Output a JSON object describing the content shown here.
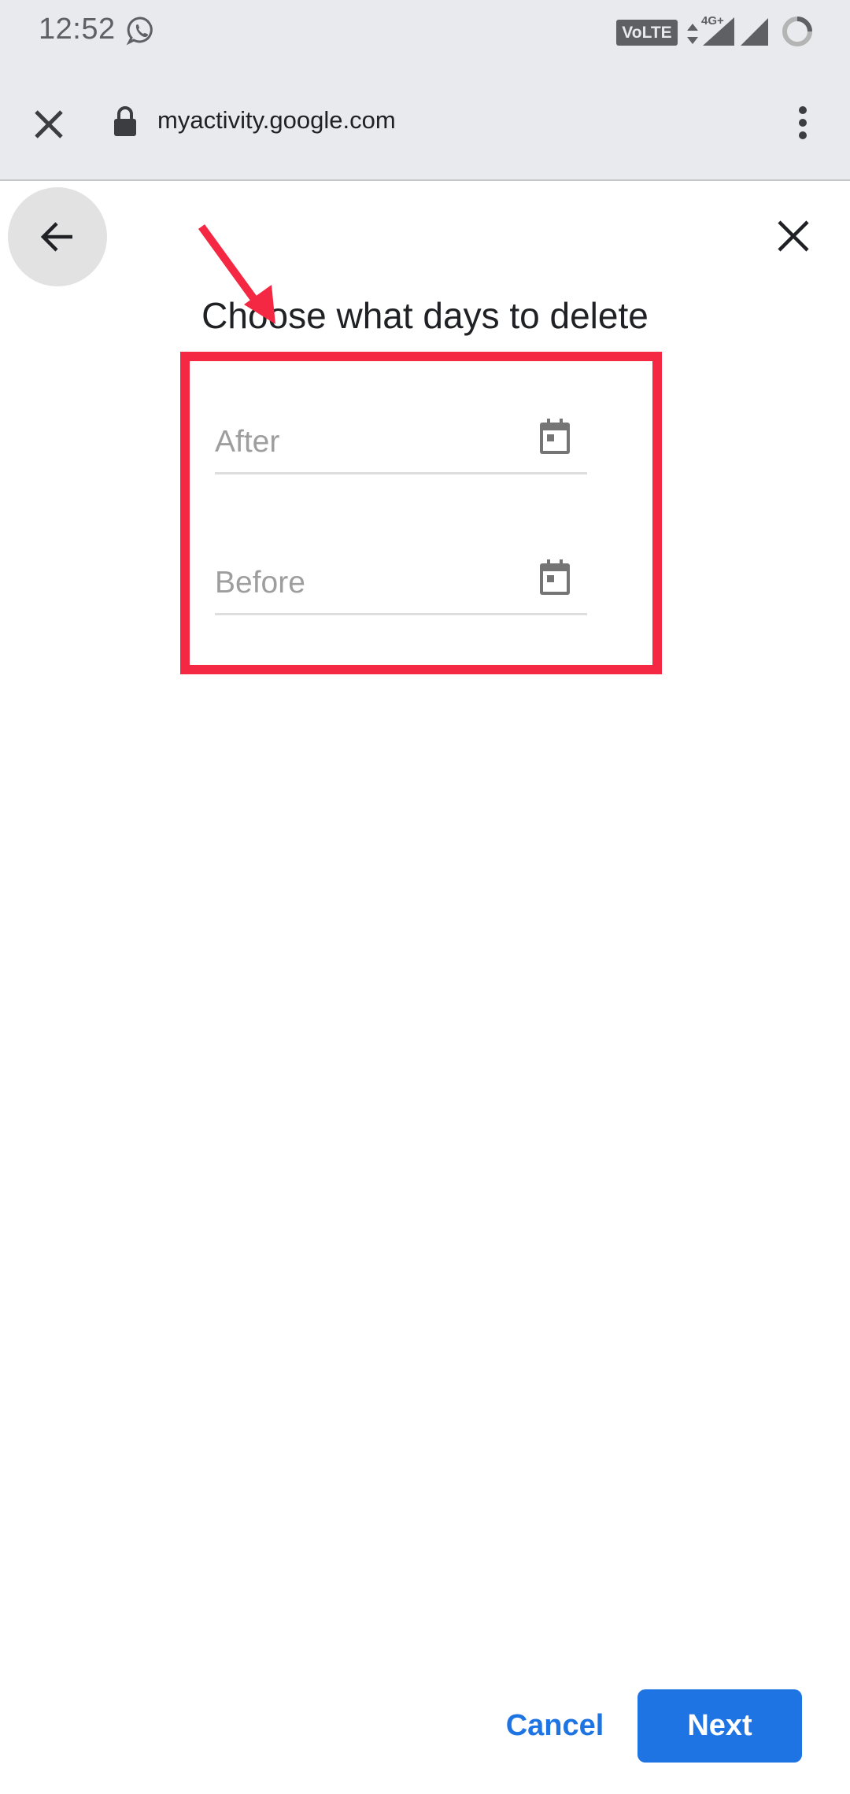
{
  "status_bar": {
    "time": "12:52",
    "notification_icons": [
      "whatsapp-icon"
    ],
    "volte_label": "VoLTE 1",
    "network_label": "4G+",
    "battery_icon": "battery-ring-icon"
  },
  "browser": {
    "url": "myactivity.google.com",
    "close_icon": "close-icon",
    "lock_icon": "lock-icon",
    "menu_icon": "more-vert-icon"
  },
  "dialog": {
    "title": "Choose what days to delete",
    "fields": [
      {
        "placeholder": "After",
        "value": "",
        "icon": "calendar-icon"
      },
      {
        "placeholder": "Before",
        "value": "",
        "icon": "calendar-icon"
      }
    ],
    "cancel_label": "Cancel",
    "next_label": "Next"
  },
  "colors": {
    "accent": "#1f74e4",
    "annotation": "#f42842",
    "toolbar_bg": "#e9eaed"
  }
}
